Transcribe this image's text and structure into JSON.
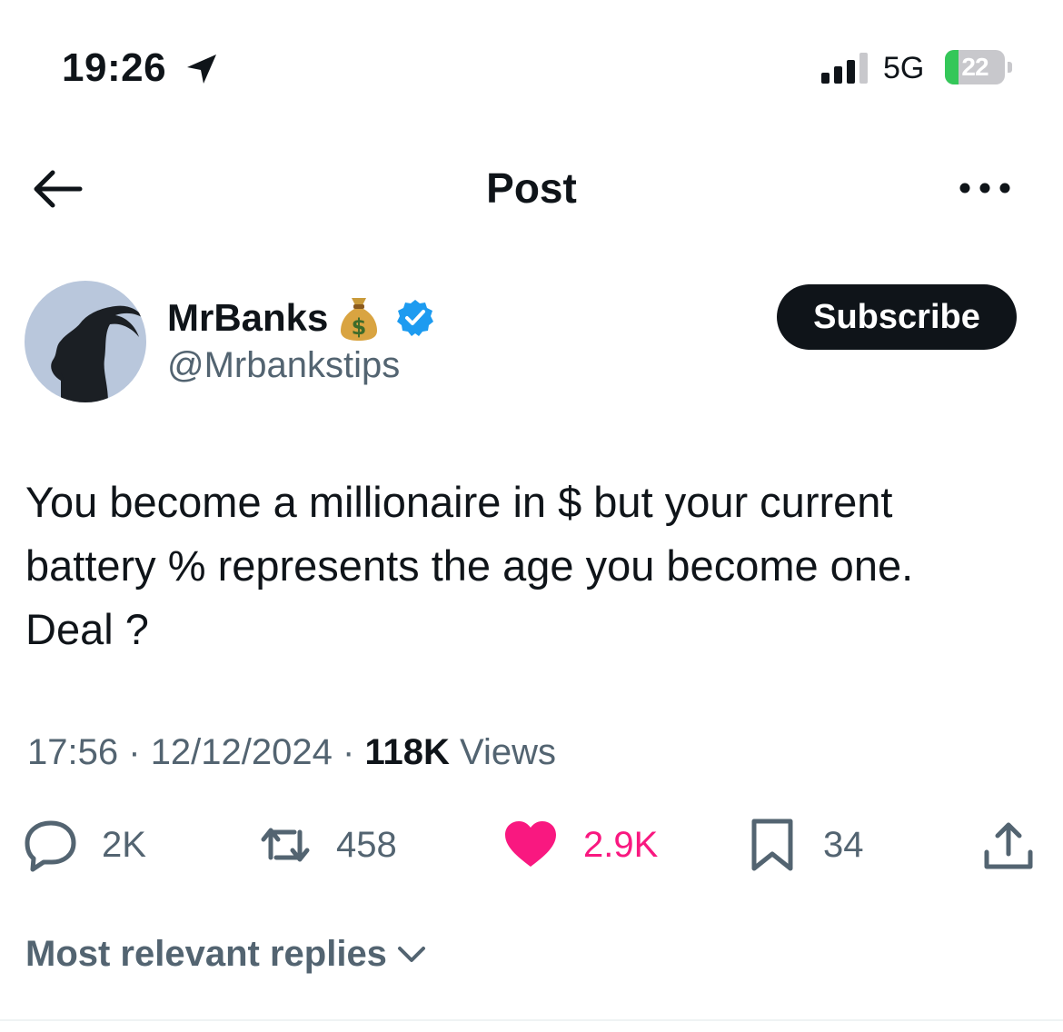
{
  "status_bar": {
    "time": "19:26",
    "network": "5G",
    "battery_percent": "22",
    "battery_level": 0.22,
    "signal_bars": 3
  },
  "nav": {
    "title": "Post"
  },
  "author": {
    "display_name": "MrBanks",
    "handle": "@Mrbankstips",
    "subscribe_label": "Subscribe"
  },
  "tweet": {
    "line1": "You become a millionaire in $ but your current",
    "line2": "battery % represents the age you become one.",
    "line3": "Deal ?"
  },
  "meta": {
    "time": "17:56",
    "separator": "·",
    "date": "12/12/2024",
    "views_count": "118K",
    "views_label": "Views"
  },
  "actions": {
    "replies": "2K",
    "reposts": "458",
    "likes": "2.9K",
    "bookmarks": "34"
  },
  "replies_filter": {
    "label": "Most relevant replies"
  },
  "colors": {
    "text": "#0f1419",
    "muted": "#536471",
    "like": "#f91880",
    "verified": "#1d9bf0",
    "battery": "#34c759"
  },
  "icons": [
    "location-arrow-icon",
    "signal-icon",
    "battery-icon",
    "back-arrow-icon",
    "more-icon",
    "money-bag-icon",
    "verified-badge-icon",
    "reply-icon",
    "repost-icon",
    "heart-icon",
    "bookmark-icon",
    "share-icon",
    "chevron-down-icon"
  ]
}
